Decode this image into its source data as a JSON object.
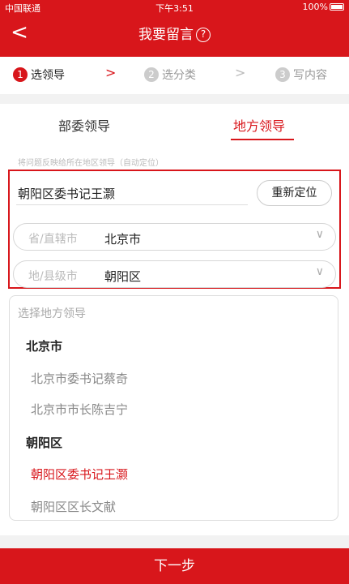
{
  "status_bar": {
    "carrier": "中国联通",
    "time": "下午3:51",
    "battery": "100%"
  },
  "nav": {
    "title": "我要留言",
    "help_glyph": "?",
    "back_glyph": "<"
  },
  "steps": [
    {
      "num": "1",
      "label": "选领导",
      "active": true
    },
    {
      "num": "2",
      "label": "选分类",
      "active": false
    },
    {
      "num": "3",
      "label": "写内容",
      "active": false
    }
  ],
  "step_arrow": ">",
  "tabs": [
    {
      "label": "部委领导",
      "active": false
    },
    {
      "label": "地方领导",
      "active": true
    }
  ],
  "hint": "将问题反映给所在地区领导（自动定位）",
  "located_leader": "朝阳区委书记王灏",
  "relocate_label": "重新定位",
  "province_select": {
    "label": "省/直辖市",
    "value": "北京市"
  },
  "city_select": {
    "label": "地/县级市",
    "value": "朝阳区"
  },
  "chevron_glyph": "∨",
  "leader_list": {
    "title": "选择地方领导",
    "groups": [
      {
        "name": "北京市",
        "items": [
          "北京市委书记蔡奇",
          "北京市市长陈吉宁"
        ]
      },
      {
        "name": "朝阳区",
        "items": [
          "朝阳区委书记王灏",
          "朝阳区区长文献"
        ]
      }
    ],
    "selected": "朝阳区委书记王灏"
  },
  "next_label": "下一步",
  "colors": {
    "accent": "#d8161b"
  }
}
